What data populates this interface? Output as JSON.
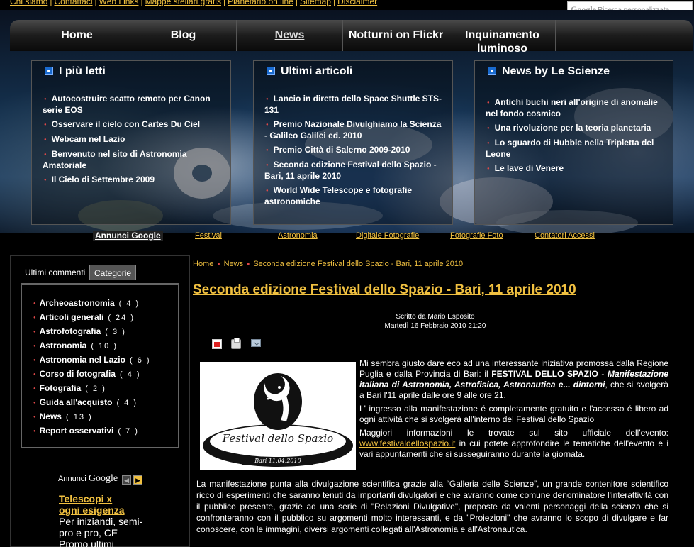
{
  "top_links": [
    "Chi siamo",
    "Contattaci",
    "Web Links",
    "Mappe stellari gratis",
    "Planetario on line",
    "Sitemap",
    "Disclaimer"
  ],
  "google_search": {
    "logo": "Google",
    "placeholder": "Ricerca personalizzata"
  },
  "nav": [
    {
      "label": "Home"
    },
    {
      "label": "Blog"
    },
    {
      "label": "News",
      "active": true
    },
    {
      "label": "Notturni on Flickr"
    },
    {
      "label": "Inquinamento luminoso"
    }
  ],
  "panels": {
    "piu_letti": {
      "title": "I più letti",
      "items": [
        "Autocostruire scatto remoto per Canon serie EOS",
        "Osservare il cielo con Cartes Du Ciel",
        "Webcam nel Lazio",
        "Benvenuto nel sito di Astronomia Amatoriale",
        "Il Cielo di Settembre 2009"
      ]
    },
    "ultimi_articoli": {
      "title": "Ultimi articoli",
      "items": [
        "Lancio in diretta dello Space Shuttle STS-131",
        "Premio Nazionale Divulghiamo la Scienza - Galileo Galilei ed. 2010",
        "Premio Città di Salerno 2009-2010",
        "Seconda edizione Festival dello Spazio - Bari, 11 aprile 2010",
        "World Wide Telescope e fotografie astronomiche"
      ]
    },
    "news_scienze": {
      "title": "News by Le Scienze",
      "items": [
        "Antichi buchi neri all'origine di anomalie nel fondo cosmico",
        "Una rivoluzione per la teoria planetaria",
        "Lo sguardo di Hubble nella Tripletta del Leone",
        "Le lave di Venere"
      ]
    }
  },
  "ad_links": {
    "label": "Annunci Google",
    "links": [
      "Festival",
      "Astronomia",
      "Digitale Fotografie",
      "Fotografie Foto",
      "Contatori Accessi"
    ]
  },
  "sidebar": {
    "tabs": [
      "Ultimi commenti",
      "Categorie"
    ],
    "categories": [
      {
        "name": "Archeoastronomia",
        "count": "( 4 )"
      },
      {
        "name": "Articoli generali",
        "count": "( 24 )"
      },
      {
        "name": "Astrofotografia",
        "count": "( 3 )"
      },
      {
        "name": "Astronomia",
        "count": "( 10 )"
      },
      {
        "name": "Astronomia nel Lazio",
        "count": "( 6 )"
      },
      {
        "name": "Corso di fotografia",
        "count": "( 4 )"
      },
      {
        "name": "Fotografia",
        "count": "( 2 )"
      },
      {
        "name": "Guida all'acquisto",
        "count": "( 4 )"
      },
      {
        "name": "News",
        "count": "( 13 )"
      },
      {
        "name": "Report osservativi",
        "count": "( 7 )"
      }
    ],
    "ad": {
      "label": "Annunci",
      "google": "Google",
      "title_line1": "Telescopi x",
      "title_line2": "ogni esigenza",
      "text": "Per iniziandi, semi-pro e pro, CE Promo ultimi"
    }
  },
  "breadcrumb": [
    "Home",
    "News",
    "Seconda edizione Festival dello Spazio - Bari, 11 aprile 2010"
  ],
  "article": {
    "title": "Seconda edizione Festival dello Spazio - Bari, 11 aprile 2010",
    "author": "Scritto da Mario Esposito",
    "date": "Martedì 16 Febbraio 2010 21:20",
    "logo_text": "Festival dello Spazio",
    "logo_date": "Bari 11.04.2010",
    "p1_a": "Mi sembra giusto dare eco ad una interessante iniziativa promossa dalla Regione Puglia e dalla Provincia di Bari: il ",
    "p1_b": "FESTIVAL DELLO SPAZIO",
    "p1_c": " - ",
    "p1_d": "Manifestazione italiana di Astronomia, Astrofisica, Astronautica e... dintorni",
    "p1_e": ", che si svolgerà a Bari l'11 aprile dalle ore 9 alle ore 21.",
    "p2": "L' ingresso alla manifestazione é completamente gratuito e l'accesso é libero ad ogni attività che si svolgerà all'interno del Festival dello Spazio",
    "p3_a": "Maggiori informazioni le trovate sul sito ufficiale dell'evento: ",
    "p3_link": "www.festivaldellospazio.it",
    "p3_b": " in cui potete approfondire le tematiche dell'evento e i vari appuntamenti che si susseguiranno durante la giornata.",
    "p4": "La manifestazione punta alla divulgazione scientifica grazie alla “Galleria delle Scienze”, un grande contenitore scientifico ricco di esperimenti che saranno tenuti da importanti divulgatori e che avranno come comune denominatore l'interattività con il pubblico presente, grazie ad una serie di \"Relazioni Divulgative\", proposte da valenti personaggi della scienza che si confronteranno con il pubblico su argomenti molto interessanti, e da \"Proiezioni\" che avranno lo scopo di divulgare e far conoscere, con le immagini, diversi argomenti collegati all'Astronomia e all'Astronautica."
  },
  "colors": {
    "accent": "#f0c040",
    "bullet": "#e04848",
    "background": "#000000"
  }
}
